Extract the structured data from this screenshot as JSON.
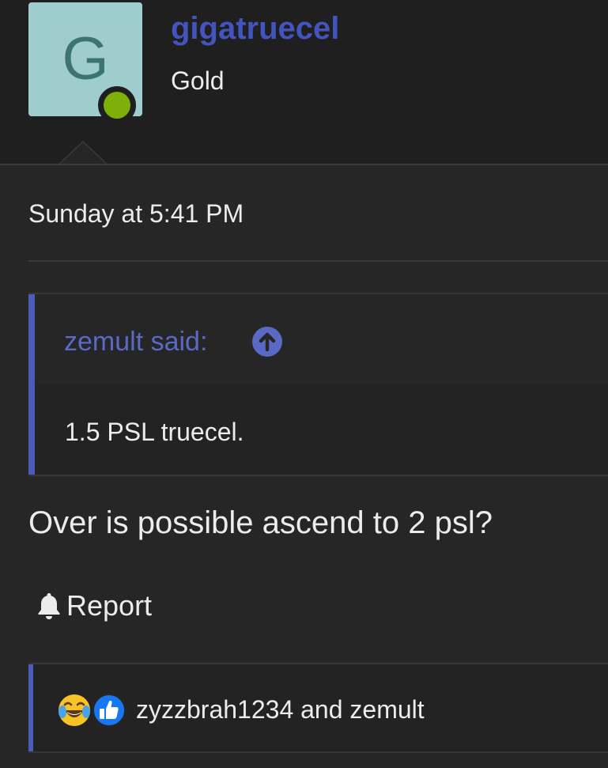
{
  "user": {
    "avatar_letter": "G",
    "username": "gigatruecel",
    "title": "Gold",
    "status": "online",
    "status_color": "#7db10a"
  },
  "post": {
    "timestamp": "Sunday at 5:41 PM",
    "quote": {
      "author_label": "zemult said:",
      "jump_icon": "arrow-up-circle-icon",
      "text": "1.5 PSL truecel."
    },
    "message": "Over is possible ascend to 2 psl?",
    "actions": {
      "report_label": "Report",
      "report_icon": "bell-icon"
    },
    "reactions": {
      "icons": [
        "laughing-crying-emoji-icon",
        "thumbs-up-icon"
      ],
      "users_text": "zyzzbrah1234 and zemult"
    }
  },
  "colors": {
    "accent": "#4454bf",
    "background": "#262626",
    "text": "#ececec"
  }
}
